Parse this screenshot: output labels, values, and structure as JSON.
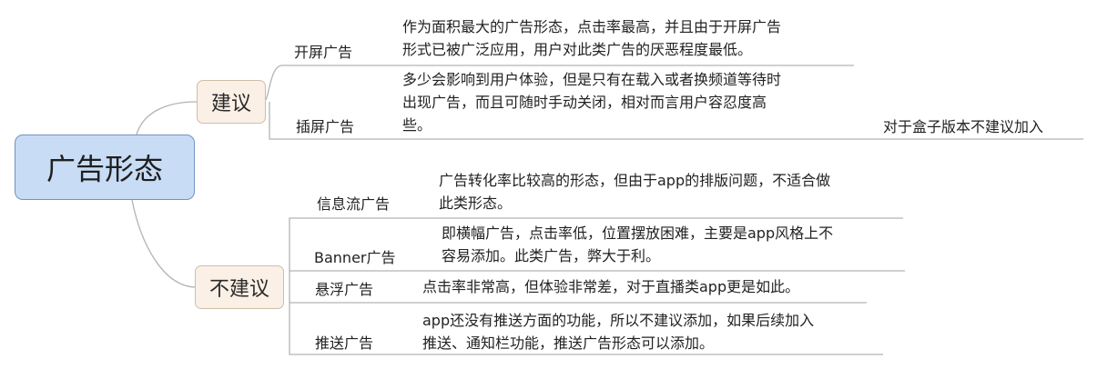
{
  "root": {
    "label": "广告形态"
  },
  "branches": [
    {
      "label": "建议",
      "items": [
        {
          "label": "开屏广告",
          "desc_lines": [
            "作为面积最大的广告形态，点击率最高，并且由于开屏广告",
            "形式已被广泛应用，用户对此类广告的厌恶程度最低。"
          ]
        },
        {
          "label": "插屏广告",
          "desc_lines": [
            "多少会影响到用户体验，但是只有在载入或者换频道等待时",
            "出现广告，而且可随时手动关闭，相对而言用户容忍度高",
            "些。"
          ],
          "note": "对于盒子版本不建议加入"
        }
      ]
    },
    {
      "label": "不建议",
      "items": [
        {
          "label": "信息流广告",
          "desc_lines": [
            "广告转化率比较高的形态，但由于app的排版问题，不适合做",
            "此类形态。"
          ]
        },
        {
          "label": "Banner广告",
          "desc_lines": [
            "即横幅广告，点击率低，位置摆放困难，主要是app风格上不",
            "容易添加。此类广告，弊大于利。"
          ]
        },
        {
          "label": "悬浮广告",
          "desc_lines": [
            "点击率非常高，但体验非常差，对于直播类app更是如此。"
          ]
        },
        {
          "label": "推送广告",
          "desc_lines": [
            "app还没有推送方面的功能，所以不建议添加，如果后续加入",
            "推送、通知栏功能，推送广告形态可以添加。"
          ]
        }
      ]
    }
  ]
}
